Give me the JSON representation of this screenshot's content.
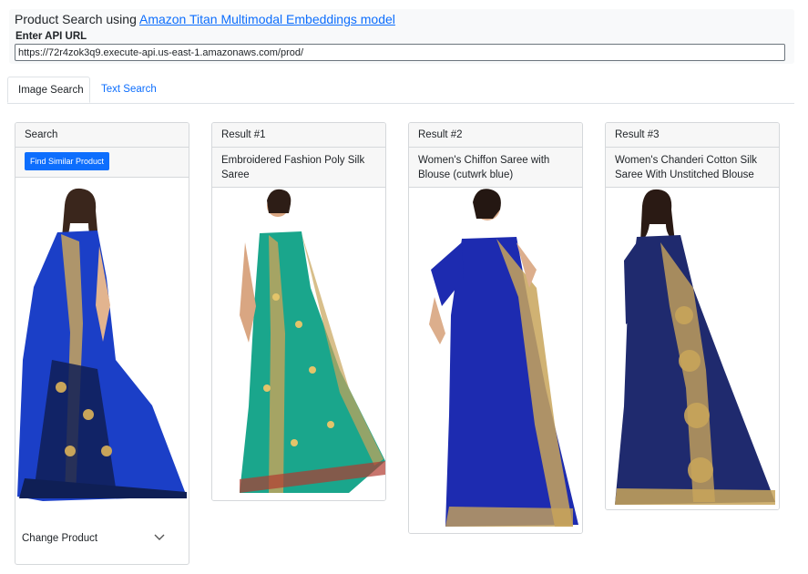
{
  "header": {
    "title_prefix": "Product Search using ",
    "title_link": "Amazon Titan Multimodal Embeddings model",
    "api_label": "Enter API URL",
    "api_url": "https://72r4zok3q9.execute-api.us-east-1.amazonaws.com/prod/"
  },
  "tabs": [
    {
      "label": "Image Search",
      "active": true
    },
    {
      "label": "Text Search",
      "active": false
    }
  ],
  "search_card": {
    "header": "Search",
    "button": "Find Similar Product",
    "select_label": "Change Product"
  },
  "results": [
    {
      "header": "Result #1",
      "title": "Embroidered Fashion Poly Silk Saree"
    },
    {
      "header": "Result #2",
      "title": "Women's Chiffon Saree with Blouse (cutwrk blue)"
    },
    {
      "header": "Result #3",
      "title": "Women's Chanderi Cotton Silk Saree With Unstitched Blouse"
    }
  ],
  "colors": {
    "accent": "#0d6efd",
    "royal_blue": "#1b3fc7",
    "teal": "#1aa68c",
    "navy": "#1f2a6e",
    "gold": "#c8a45a"
  }
}
